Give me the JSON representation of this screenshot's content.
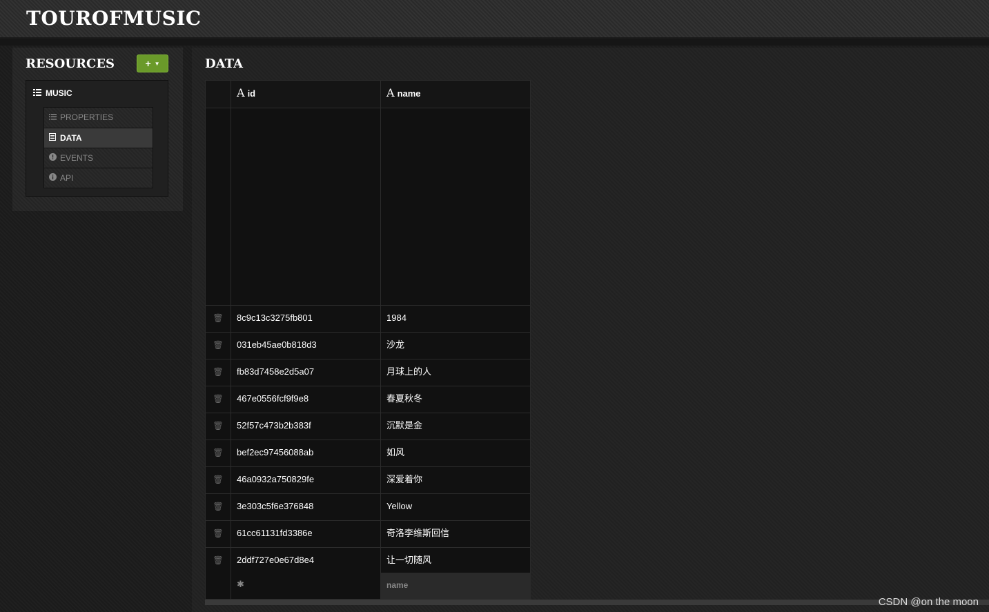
{
  "app": {
    "brand": "TOUROFMUSIC"
  },
  "sidebar": {
    "title": "RESOURCES",
    "add_button": {
      "label": "+",
      "icon": "plus-icon",
      "caret_icon": "caret-down-icon"
    },
    "resource": {
      "label": "MUSIC",
      "icon": "list-icon"
    },
    "items": [
      {
        "label": "PROPERTIES",
        "icon": "list-icon",
        "active": false
      },
      {
        "label": "DATA",
        "icon": "document-icon",
        "active": true
      },
      {
        "label": "EVENTS",
        "icon": "exclamation-circle-icon",
        "active": false
      },
      {
        "label": "API",
        "icon": "info-circle-icon",
        "active": false
      }
    ]
  },
  "main": {
    "title": "DATA",
    "table": {
      "columns": [
        {
          "type_glyph": "A",
          "label": "id"
        },
        {
          "type_glyph": "A",
          "label": "name"
        }
      ],
      "rows": [
        {
          "id": "8c9c13c3275fb801",
          "name": "1984"
        },
        {
          "id": "031eb45ae0b818d3",
          "name": "沙龙"
        },
        {
          "id": "fb83d7458e2d5a07",
          "name": "月球上的人"
        },
        {
          "id": "467e0556fcf9f9e8",
          "name": "春夏秋冬"
        },
        {
          "id": "52f57c473b2b383f",
          "name": "沉默是金"
        },
        {
          "id": "bef2ec97456088ab",
          "name": "如风"
        },
        {
          "id": "46a0932a750829fe",
          "name": "深爱着你"
        },
        {
          "id": "3e303c5f6e376848",
          "name": "Yellow"
        },
        {
          "id": "61cc61131fd3386e",
          "name": "奇洛李维斯回信"
        },
        {
          "id": "2ddf727e0e67d8e4",
          "name": "让一切随风"
        }
      ],
      "new_row": {
        "id_marker": "✱",
        "name_placeholder": "name"
      }
    }
  },
  "watermark": "CSDN @on the moon",
  "colors": {
    "accent_green": "#6a9a2a",
    "background": "#1c1c1c"
  }
}
